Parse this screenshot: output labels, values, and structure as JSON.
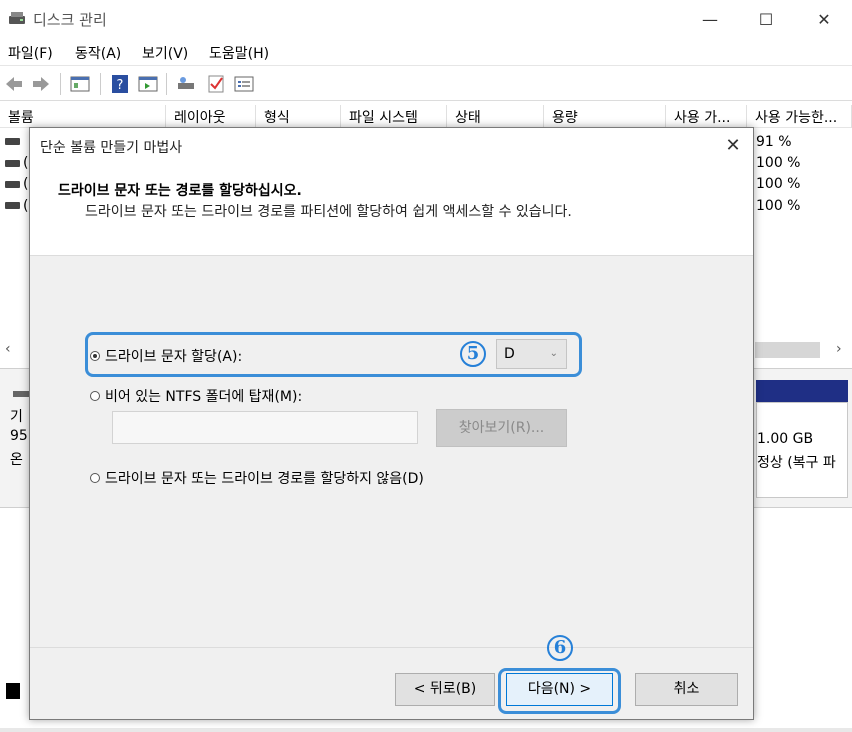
{
  "window": {
    "title": "디스크 관리",
    "min": "—",
    "max": "☐",
    "close": "✕"
  },
  "menu": [
    "파일(F)",
    "동작(A)",
    "보기(V)",
    "도움말(H)"
  ],
  "toolbar_icons": [
    "back-arrow-icon",
    "forward-arrow-icon",
    "disk-list-icon",
    "help-icon",
    "properties-icon",
    "rescan-icon",
    "check-icon",
    "settings-list-icon"
  ],
  "volume_list": {
    "columns": [
      "볼륨",
      "레이아웃",
      "형식",
      "파일 시스템",
      "상태",
      "용량",
      "사용 가...",
      "사용 가능한..."
    ],
    "rows": [
      {
        "free_pct": "91 %",
        "name_frag": ""
      },
      {
        "free_pct": "100 %",
        "name_frag": "("
      },
      {
        "free_pct": "100 %",
        "name_frag": "("
      },
      {
        "free_pct": "100 %",
        "name_frag": "("
      }
    ]
  },
  "scroll": {
    "left": "‹",
    "right": "›"
  },
  "disk_panel": {
    "left_line1": "기",
    "left_line2": "95",
    "left_line3": "온",
    "partition_size": "1.00 GB",
    "partition_status": "정상 (복구 파"
  },
  "dialog": {
    "title": "단순 볼륨 만들기 마법사",
    "close": "✕",
    "heading": "드라이브 문자 또는 경로를 할당하십시오.",
    "subheading": "드라이브 문자 또는 드라이브 경로를 파티션에 할당하여 쉽게 액세스할 수 있습니다.",
    "options": {
      "assign_letter": "드라이브 문자 할당(A):",
      "mount_folder": "비어 있는 NTFS 폴더에 탑재(M):",
      "no_assign": "드라이브 문자 또는 드라이브 경로를 할당하지 않음(D)"
    },
    "drive_letter": "D",
    "dropdown_arrow": "⌄",
    "browse_label": "찾아보기(R)...",
    "buttons": {
      "back": "< 뒤로(B)",
      "next": "다음(N) >",
      "cancel": "취소"
    }
  },
  "annotations": {
    "step5": "5",
    "step6": "6"
  },
  "colors": {
    "highlight": "#3b8ed8",
    "partition_bar": "#1f2f85",
    "next_button_border": "#0078d7"
  }
}
